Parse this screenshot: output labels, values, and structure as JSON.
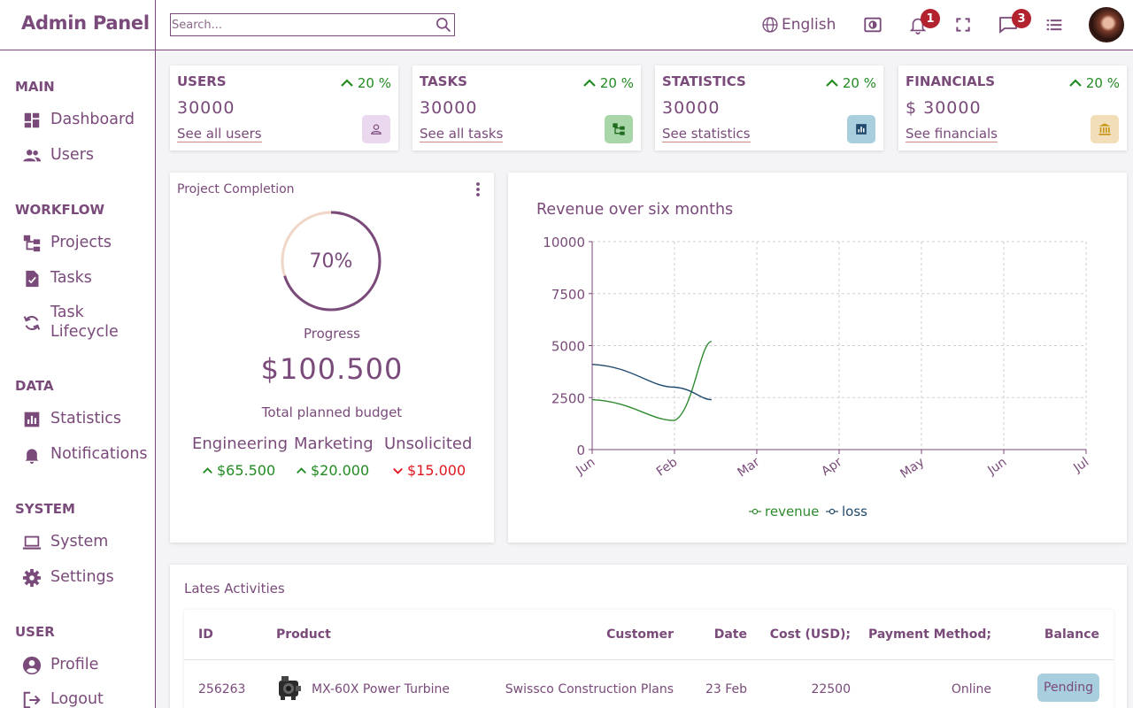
{
  "app": {
    "title": "Admin Panel"
  },
  "search": {
    "placeholder": "Search..."
  },
  "header": {
    "language": "English",
    "notifications_count": "1",
    "messages_count": "3"
  },
  "sidebar": {
    "sections": [
      {
        "title": "MAIN",
        "items": [
          {
            "label": "Dashboard",
            "icon": "dashboard-icon"
          },
          {
            "label": "Users",
            "icon": "users-icon"
          }
        ]
      },
      {
        "title": "WORKFLOW",
        "items": [
          {
            "label": "Projects",
            "icon": "projects-icon"
          },
          {
            "label": "Tasks",
            "icon": "tasks-icon"
          },
          {
            "label": "Task Lifecycle",
            "icon": "lifecycle-icon"
          }
        ]
      },
      {
        "title": "DATA",
        "items": [
          {
            "label": "Statistics",
            "icon": "statistics-icon"
          },
          {
            "label": "Notifications",
            "icon": "bell-icon"
          }
        ]
      },
      {
        "title": "SYSTEM",
        "items": [
          {
            "label": "System",
            "icon": "laptop-icon"
          },
          {
            "label": "Settings",
            "icon": "gear-icon"
          }
        ]
      },
      {
        "title": "USER",
        "items": [
          {
            "label": "Profile",
            "icon": "profile-icon"
          },
          {
            "label": "Logout",
            "icon": "logout-icon"
          }
        ]
      }
    ]
  },
  "stats": [
    {
      "title": "USERS",
      "pct": "20 %",
      "value": "30000",
      "link": "See all users",
      "icon": "user-icon",
      "icon_bg": "#ead9ee",
      "icon_color": "#7a4a7a"
    },
    {
      "title": "TASKS",
      "pct": "20 %",
      "value": "30000",
      "link": "See all tasks",
      "icon": "projects-icon",
      "icon_bg": "#a9d6a9",
      "icon_color": "#1e6b1e"
    },
    {
      "title": "STATISTICS",
      "pct": "20 %",
      "value": "30000",
      "link": "See statistics",
      "icon": "statistics-icon",
      "icon_bg": "#a9cfdf",
      "icon_color": "#1f4a6e"
    },
    {
      "title": "FINANCIALS",
      "pct": "20 %",
      "value": "$ 30000",
      "link": "See financials",
      "icon": "bank-icon",
      "icon_bg": "#f2deb8",
      "icon_color": "#c9951a"
    }
  ],
  "project": {
    "title": "Project Completion",
    "percent": "70%",
    "progress_fraction": 0.7,
    "progress_label": "Progress",
    "amount": "$100.500",
    "budget_label": "Total planned budget",
    "categories": [
      {
        "name": "Engineering",
        "value": "$65.500",
        "trend": "up"
      },
      {
        "name": "Marketing",
        "value": "$20.000",
        "trend": "up"
      },
      {
        "name": "Unsolicited",
        "value": "$15.000",
        "trend": "down"
      }
    ]
  },
  "chart_data": {
    "type": "line",
    "title": "Revenue over six months",
    "categories": [
      "Jun",
      "Feb",
      "Mar",
      "Apr",
      "May",
      "Jun",
      "Jul"
    ],
    "ylim": [
      0,
      10000
    ],
    "yticks": [
      "10000",
      "7500",
      "5000",
      "2500",
      "0"
    ],
    "grid": true,
    "legend_position": "bottom",
    "series": [
      {
        "name": "revenue",
        "color": "#2e8b2e",
        "x": [
          0,
          1,
          1.45
        ],
        "values": [
          2400,
          1400,
          5200
        ]
      },
      {
        "name": "loss",
        "color": "#1f4a6e",
        "x": [
          0,
          1,
          1.45
        ],
        "values": [
          4100,
          3000,
          2400
        ]
      }
    ]
  },
  "activities": {
    "title": "Lates Activities",
    "columns": [
      "ID",
      "Product",
      "Customer",
      "Date",
      "Cost (USD);",
      "Payment Method;",
      "Balance"
    ],
    "rows": [
      {
        "id": "256263",
        "product": "MX-60X Power Turbine",
        "customer": "Swissco Construction Plans",
        "date": "23 Feb",
        "cost": "22500",
        "payment": "Online",
        "balance": "Pending"
      }
    ]
  }
}
